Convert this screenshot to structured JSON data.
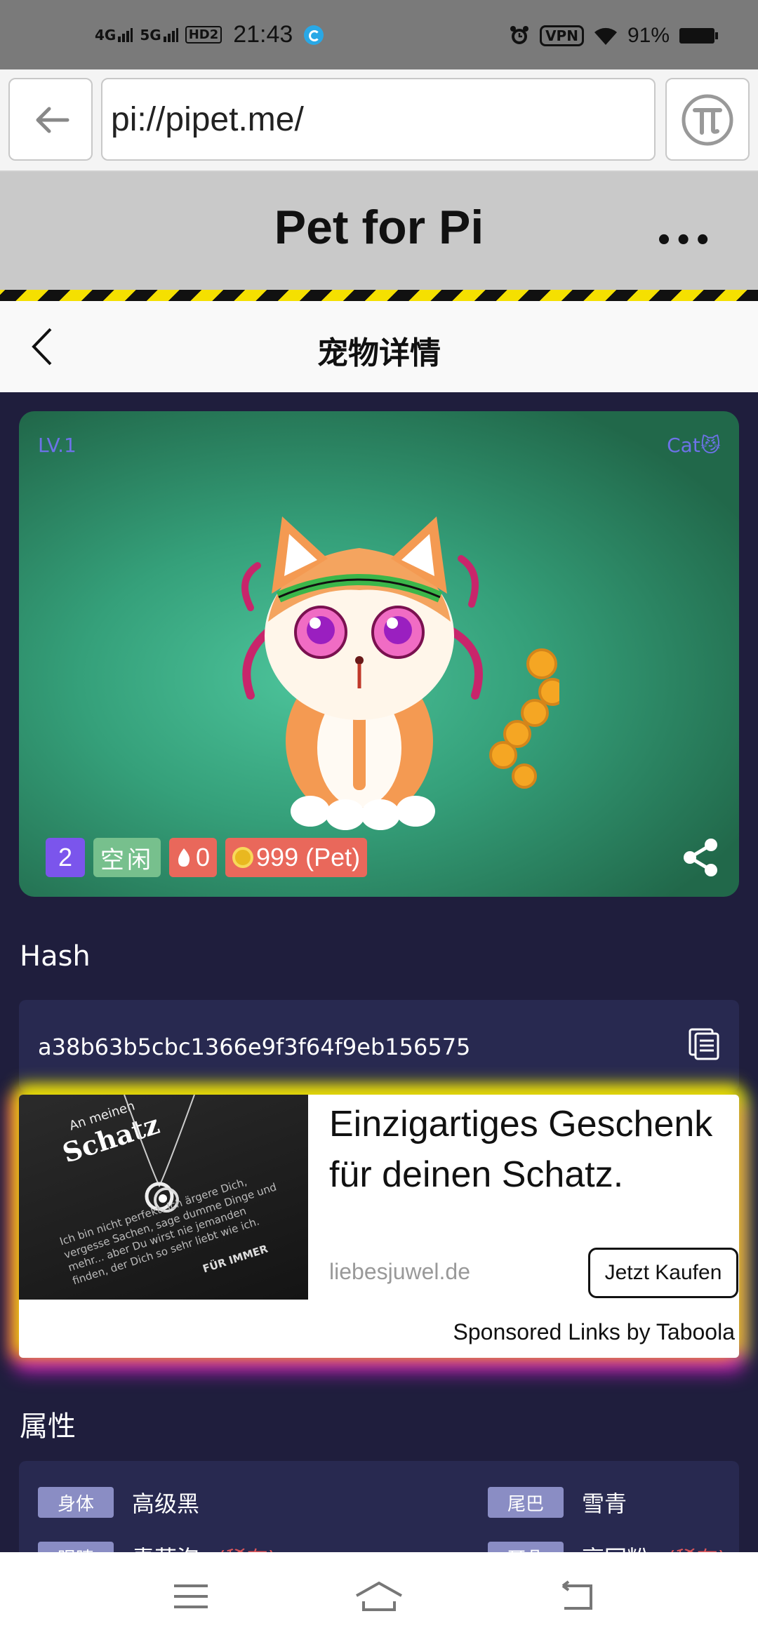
{
  "status_bar": {
    "network_1": "4G",
    "network_2": "5G",
    "hd_label": "HD2",
    "time": "21:43",
    "vpn_label": "VPN",
    "battery": "91%"
  },
  "browser": {
    "url": "pi://pipet.me/",
    "back_icon": "arrow-left-icon",
    "pi_icon": "pi-logo-icon"
  },
  "app_header": {
    "title": "Pet for Pi",
    "menu_label": "•••"
  },
  "page_nav": {
    "title": "宠物详情"
  },
  "pet_card": {
    "level": "LV.1",
    "species": "Cat😼",
    "tags": {
      "number": "2",
      "status": "空闲",
      "fire_count": "0",
      "price": "999 (Pet)"
    },
    "colors": {
      "level_text": "#6d72e8",
      "number_tag": "#7b55ec",
      "status_tag": "#77c08d",
      "price_tag": "#e9685b"
    }
  },
  "hash_section": {
    "label": "Hash",
    "value": "a38b63b5cbc1366e9f3f64f9eb156575"
  },
  "ad": {
    "image_title": "Schatz",
    "image_subtitle": "An meinen",
    "image_text": "Ich bin nicht perfekt. Ich ärgere Dich, vergesse Sachen, sage dumme Dinge und mehr... aber Du wirst nie jemanden finden, der Dich so sehr liebt wie ich.",
    "image_bold": "FÜR IMMER",
    "headline": "Einzigartiges Geschenk für deinen Schatz.",
    "domain": "liebesjuwel.de",
    "cta": "Jetzt Kaufen",
    "sponsor": "Sponsored Links by Taboola"
  },
  "attributes": {
    "label": "属性",
    "items": [
      {
        "key": "身体",
        "value": "高级黑",
        "note": ""
      },
      {
        "key": "尾巴",
        "value": "雪青",
        "note": ""
      },
      {
        "key": "眼睛",
        "value": "青草泡",
        "note": "(稀有)"
      },
      {
        "key": "耳朵",
        "value": "亮回粉",
        "note": "(稀有)"
      }
    ]
  },
  "bottom_nav": {
    "items": [
      "menu-icon",
      "home-icon",
      "back-icon"
    ]
  }
}
